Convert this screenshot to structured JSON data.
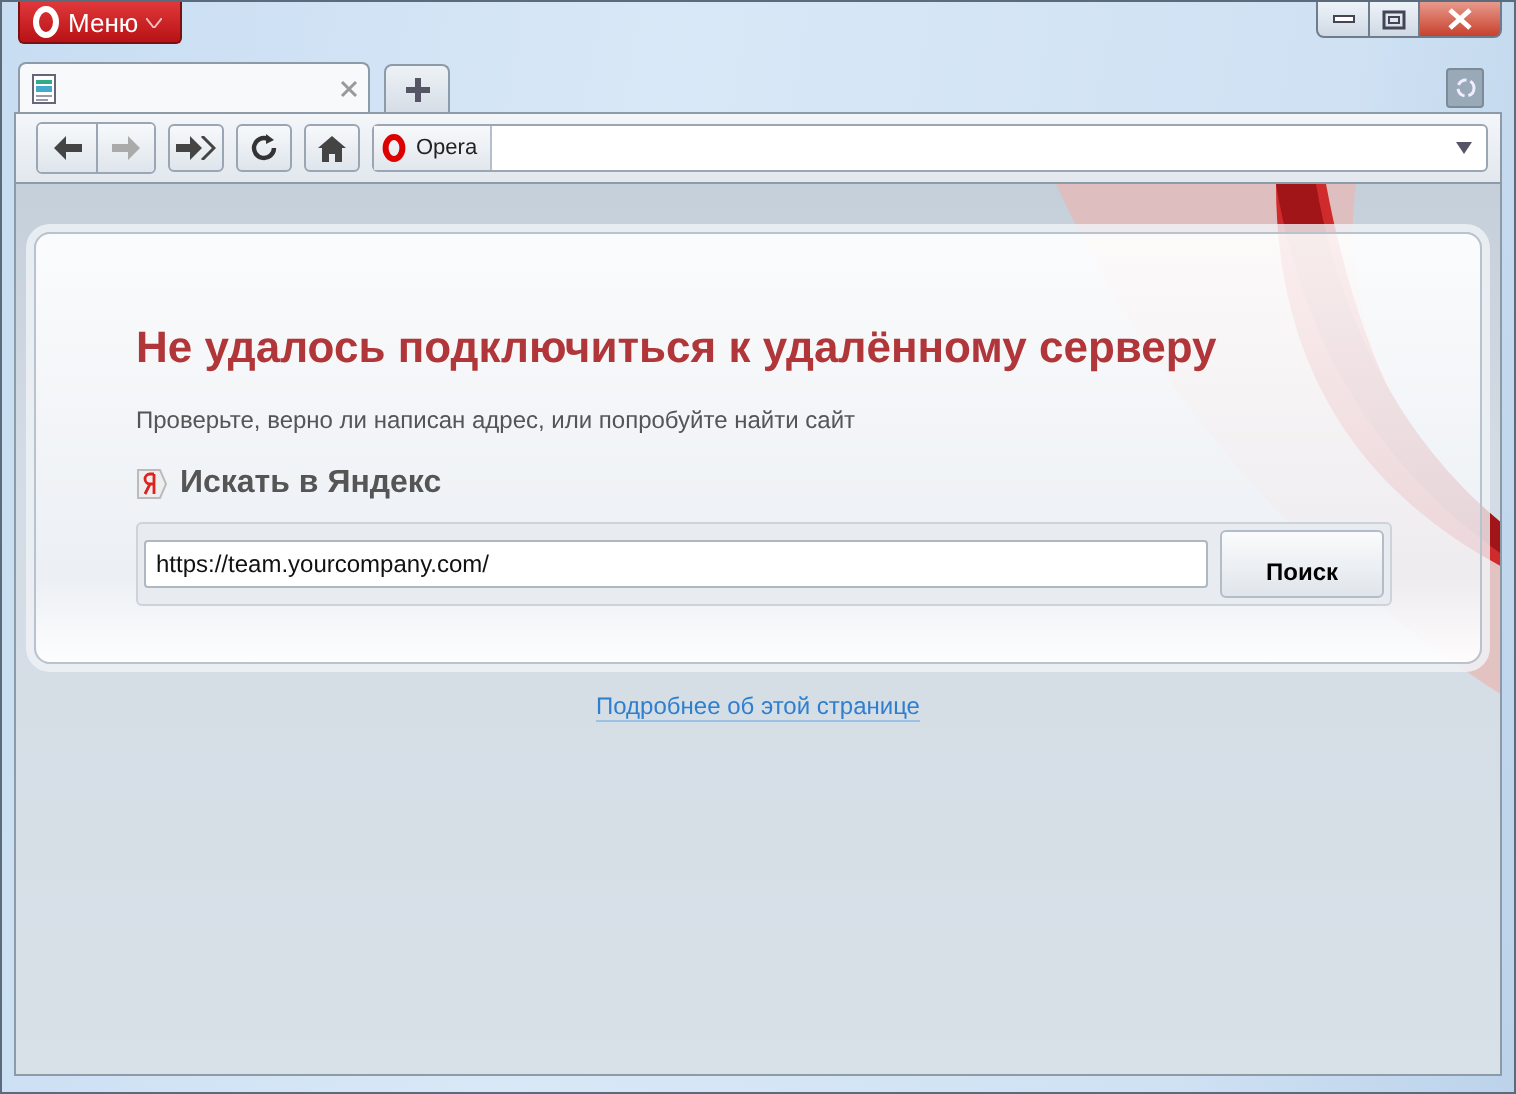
{
  "menu_button": {
    "label": "Меню"
  },
  "tabs": [
    {
      "kind": "page",
      "selected": true
    }
  ],
  "address_bar": {
    "site_badge": "Opera"
  },
  "error": {
    "title": "Не удалось подключиться к удалённому серверу",
    "message": "Проверьте, верно ли написан адрес, или попробуйте найти сайт",
    "search_label": "Искать в Яндекс",
    "search_value": "https://team.yourcompany.com/",
    "search_button": "Поиск"
  },
  "more_link": "Подробнее об этой странице"
}
